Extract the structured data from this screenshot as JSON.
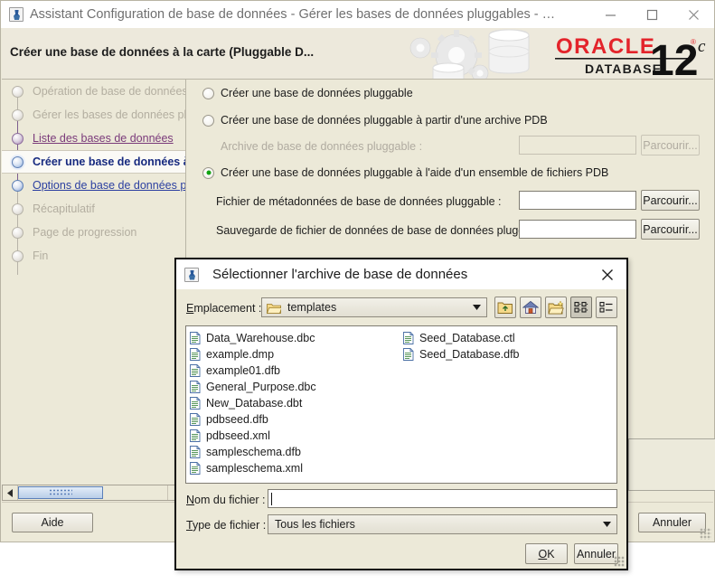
{
  "window": {
    "title": "Assistant Configuration de base de données - Gérer les bases de données pluggables - …",
    "icon": "java-app-icon",
    "minimize_label": "minimize-icon",
    "maximize_label": "maximize-icon",
    "close_label": "close-icon"
  },
  "banner": {
    "heading": "Créer une base de données à la carte (Pluggable D...",
    "brand": "ORACLE",
    "brand_sub": "DATABASE",
    "version": "12",
    "version_sup": "c",
    "brand_color": "#e3242b"
  },
  "sidebar": {
    "items": [
      {
        "label": "Opération de base de données",
        "state": "pending"
      },
      {
        "label": "Gérer les bases de données plugg",
        "state": "pending"
      },
      {
        "label": "Liste des bases de données",
        "state": "done"
      },
      {
        "label": "Créer une base de données à",
        "state": "current"
      },
      {
        "label": "Options de base de données plugg",
        "state": "next"
      },
      {
        "label": "Récapitulatif",
        "state": "pending"
      },
      {
        "label": "Page de progression",
        "state": "pending"
      },
      {
        "label": "Fin",
        "state": "pending"
      }
    ],
    "scroll_left_icon": "scroll-left-arrow-icon"
  },
  "content": {
    "options": [
      {
        "label": "Créer une base de données pluggable",
        "selected": false,
        "enabled": true
      },
      {
        "label": "Créer une base de données pluggable à partir d'une archive PDB",
        "selected": false,
        "enabled": true
      },
      {
        "label": "Créer une base de données pluggable à l'aide d'un ensemble de fichiers PDB",
        "selected": true,
        "enabled": true
      }
    ],
    "fields": [
      {
        "label": "Archive de base de données pluggable :",
        "value": "",
        "enabled": false,
        "browse": "Parcourir..."
      },
      {
        "label": "Fichier de métadonnées de base de données pluggable :",
        "value": "",
        "enabled": true,
        "browse": "Parcourir..."
      },
      {
        "label": "Sauvegarde de fichier de données de base de données pluggable :",
        "value": "",
        "enabled": true,
        "browse": "Parcourir..."
      }
    ]
  },
  "footer": {
    "help_label": "Aide",
    "cancel_label": "Annuler"
  },
  "file_dialog": {
    "title": "Sélectionner l'archive de base de données",
    "icon": "java-app-icon",
    "close_icon": "close-icon",
    "location_label": "Emplacement :",
    "location_value": "templates",
    "toolbar": [
      {
        "name": "up-folder-icon"
      },
      {
        "name": "home-icon"
      },
      {
        "name": "new-folder-icon"
      },
      {
        "name": "tiles-view-icon",
        "pressed": true
      },
      {
        "name": "list-details-view-icon",
        "pressed": false
      }
    ],
    "files_column_1": [
      "Data_Warehouse.dbc",
      "example.dmp",
      "example01.dfb",
      "General_Purpose.dbc",
      "New_Database.dbt",
      "pdbseed.dfb",
      "pdbseed.xml",
      "sampleschema.dfb",
      "sampleschema.xml"
    ],
    "files_column_2": [
      "Seed_Database.ctl",
      "Seed_Database.dfb"
    ],
    "filename_label": "Nom du fichier :",
    "filename_value": "",
    "filetype_label": "Type de fichier :",
    "filetype_value": "Tous les fichiers",
    "ok_label": "OK",
    "cancel_label": "Annuler"
  }
}
